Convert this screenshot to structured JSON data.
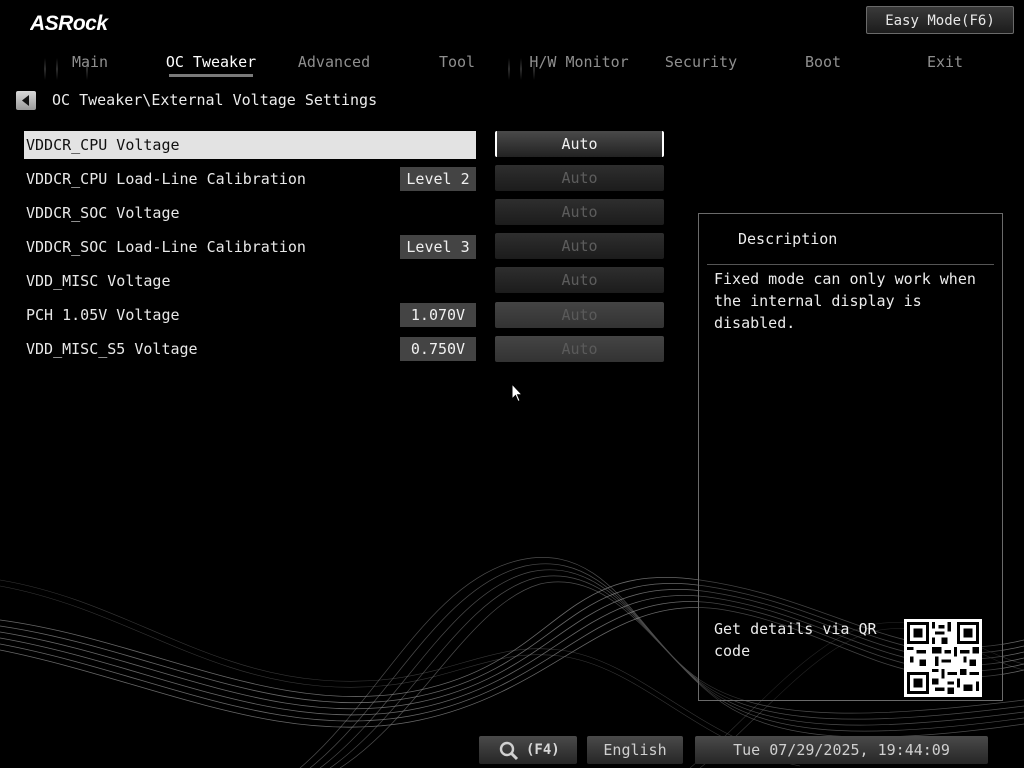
{
  "brand": {
    "logo_text": "ASRock"
  },
  "header": {
    "easy_mode_label": "Easy Mode(F6)"
  },
  "tabs": [
    {
      "label": "Main",
      "active": false
    },
    {
      "label": "OC Tweaker",
      "active": true
    },
    {
      "label": "Advanced",
      "active": false
    },
    {
      "label": "Tool",
      "active": false
    },
    {
      "label": "H/W Monitor",
      "active": false
    },
    {
      "label": "Security",
      "active": false
    },
    {
      "label": "Boot",
      "active": false
    },
    {
      "label": "Exit",
      "active": false
    }
  ],
  "breadcrumb": "OC Tweaker\\External Voltage Settings",
  "settings": [
    {
      "label": "VDDCR_CPU Voltage",
      "value": "",
      "option": "Auto",
      "state": "selected"
    },
    {
      "label": "VDDCR_CPU Load-Line Calibration",
      "value": "Level 2",
      "option": "Auto",
      "state": "disabled"
    },
    {
      "label": "VDDCR_SOC Voltage",
      "value": "",
      "option": "Auto",
      "state": "disabled"
    },
    {
      "label": "VDDCR_SOC Load-Line Calibration",
      "value": "Level 3",
      "option": "Auto",
      "state": "disabled"
    },
    {
      "label": "VDD_MISC Voltage",
      "value": "",
      "option": "Auto",
      "state": "disabled"
    },
    {
      "label": "PCH 1.05V Voltage",
      "value": "1.070V",
      "option": "Auto",
      "state": "disabled"
    },
    {
      "label": "VDD_MISC_S5 Voltage",
      "value": "0.750V",
      "option": "Auto",
      "state": "disabled"
    }
  ],
  "description": {
    "title": "Description",
    "text": "Fixed mode can only work when the internal display is disabled.",
    "qr_text": "Get details via QR code"
  },
  "footer": {
    "search_key": "(F4)",
    "language": "English",
    "datetime": "Tue 07/29/2025, 19:44:09"
  },
  "colors": {
    "background": "#000000",
    "selected_row": "#e3e3e3",
    "value_box": "#444444",
    "panel_border": "#6a6a6a"
  },
  "icons": [
    "back-arrow-icon",
    "search-icon",
    "mouse-cursor-icon",
    "qr-code-icon"
  ]
}
